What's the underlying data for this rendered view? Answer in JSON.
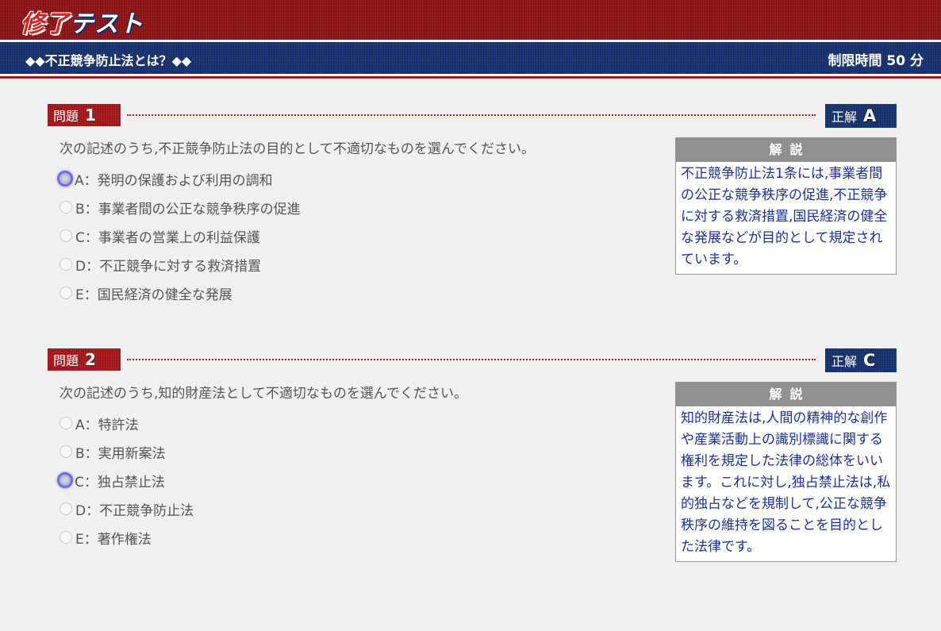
{
  "header": {
    "title_part1": "修了",
    "title_part2": "テスト",
    "subtitle": "◆◆不正競争防止法とは？◆◆",
    "time_limit": "制限時間 50 分"
  },
  "questions": [
    {
      "label": "問題",
      "number": "1",
      "answer_label": "正解",
      "answer": "A",
      "text": "次の記述のうち,不正競争防止法の目的として不適切なものを選んでください。",
      "selected": "A",
      "choices": [
        {
          "letter": "A",
          "text": "A：発明の保護および利用の調和"
        },
        {
          "letter": "B",
          "text": "B：事業者間の公正な競争秩序の促進"
        },
        {
          "letter": "C",
          "text": "C：事業者の営業上の利益保護"
        },
        {
          "letter": "D",
          "text": "D：不正競争に対する救済措置"
        },
        {
          "letter": "E",
          "text": "E：国民経済の健全な発展"
        }
      ],
      "explanation_title": "解説",
      "explanation": "不正競争防止法1条には,事業者間の公正な競争秩序の促進,不正競争に対する救済措置,国民経済の健全な発展などが目的として規定されています。"
    },
    {
      "label": "問題",
      "number": "2",
      "answer_label": "正解",
      "answer": "C",
      "text": "次の記述のうち,知的財産法として不適切なものを選んでください。",
      "selected": "C",
      "choices": [
        {
          "letter": "A",
          "text": "A：特許法"
        },
        {
          "letter": "B",
          "text": "B：実用新案法"
        },
        {
          "letter": "C",
          "text": "C：独占禁止法"
        },
        {
          "letter": "D",
          "text": "D：不正競争防止法"
        },
        {
          "letter": "E",
          "text": "E：著作権法"
        }
      ],
      "explanation_title": "解説",
      "explanation": "知的財産法は,人間の精神的な創作や産業活動上の識別標識に関する権利を規定した法律の総体をいいます。これに対し,独占禁止法は,私的独占などを規制して,公正な競争秩序の維持を図ることを目的とした法律です。"
    }
  ],
  "colors": {
    "header_red": "#9b1b1d",
    "header_blue": "#1f3a7a",
    "explanation_text": "#1a30a0",
    "selected_radio": "#6c6cf0"
  }
}
